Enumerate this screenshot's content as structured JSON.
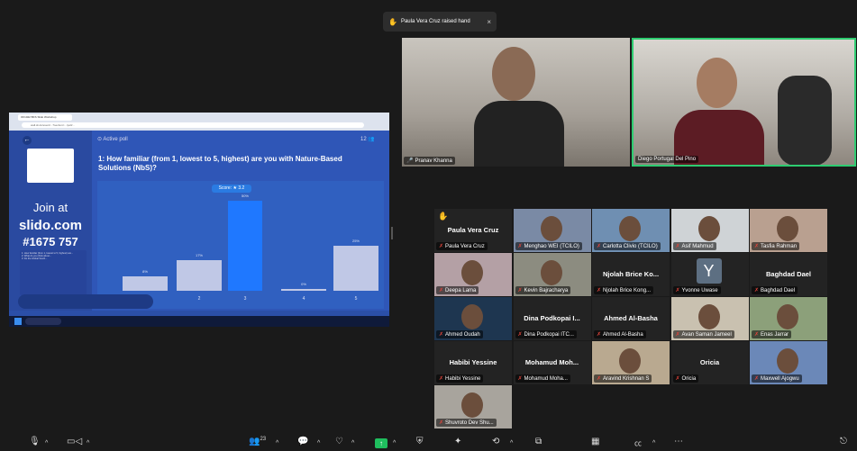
{
  "notification": {
    "text": "Paula Vera Cruz raised hand",
    "close": "×",
    "hand_icon": "raised-hand-icon"
  },
  "shared_screen": {
    "browser_tab": "OF1022 BKS Slido Workshop",
    "browser_url": "wall.sli.do/event/...?section=.../poll/...",
    "slido": {
      "back": "←",
      "active_poll": "Active poll",
      "participant_count": "12",
      "join_label": "Join at",
      "site": "slido.com",
      "code": "#1675 757",
      "question": "1: How familiar (from 1, lowest to 5, highest) are you with Nature-Based Solutions (NbS)?",
      "score_badge": "Score: ★ 3.2",
      "question_list": [
        "1: How familiar (from 1, lowest to 5, highest) are...",
        "2: What do you think about...",
        "3: Do the Global South..."
      ]
    }
  },
  "chart_data": {
    "type": "bar",
    "categories": [
      "1",
      "2",
      "3",
      "4",
      "5"
    ],
    "values": [
      8,
      17,
      50,
      0,
      25
    ],
    "value_labels": [
      "8%",
      "17%",
      "50%",
      "0%",
      "25%"
    ],
    "highlight_index": 2,
    "ylim": [
      0,
      50
    ],
    "title": "1: How familiar (from 1, lowest to 5, highest) are you with Nature-Based Solutions (NbS)?"
  },
  "top_videos": [
    {
      "name": "Pranav Khanna",
      "bg": "#b8b3ac"
    },
    {
      "name": "Diego Portugal Del Pino",
      "bg": "#a8a39b"
    }
  ],
  "gallery": [
    {
      "name": "Paula Vera Cruz",
      "label": "Paula Vera Cruz",
      "video": false,
      "hand": true
    },
    {
      "name": "Menghao WEI (TCILO)",
      "video": true,
      "bg": "#7a8aa5"
    },
    {
      "name": "Carlotta Clivio (TCILO)",
      "video": true,
      "bg": "#6f8fb2"
    },
    {
      "name": "Asif Mahmud",
      "video": true,
      "bg": "#cfd3d6"
    },
    {
      "name": "Tasfia Rahman",
      "video": true,
      "bg": "#b9a090"
    },
    {
      "name": "Deepa Lama",
      "video": true,
      "bg": "#b4a0a5"
    },
    {
      "name": "Kevin Bajracharya",
      "video": true,
      "bg": "#8c8c80"
    },
    {
      "name": "Njolah Brice Kong...",
      "label": "Njolah Brice Ko...",
      "video": false
    },
    {
      "name": "Yvonne Uwase",
      "avatar": "Y",
      "video": false
    },
    {
      "name": "Baghdad Dael",
      "label": "Baghdad Dael",
      "video": false
    },
    {
      "name": "Ahmed Oudah",
      "video": true,
      "bg": "#1e3650"
    },
    {
      "name": "Dina Podkopai ITC...",
      "label": "Dina Podkopai I...",
      "video": false
    },
    {
      "name": "Ahmed Al-Basha",
      "label": "Ahmed Al-Basha",
      "video": false
    },
    {
      "name": "Avan Saman Jameel",
      "video": true,
      "bg": "#c9c1b0"
    },
    {
      "name": "Enas Jarrar",
      "video": true,
      "bg": "#8ca07a"
    },
    {
      "name": "Habibi Yessine",
      "label": "Habibi Yessine",
      "video": false
    },
    {
      "name": "Mohamud Moha...",
      "label": "Mohamud Moh...",
      "video": false
    },
    {
      "name": "Aravind Krishnan S",
      "video": true,
      "bg": "#b9a990"
    },
    {
      "name": "Oricia",
      "label": "Oricia",
      "video": false
    },
    {
      "name": "Maxwell Ajogwu",
      "video": true,
      "bg": "#6b88b8"
    },
    {
      "name": "Shuvroto Dev Shu...",
      "video": true,
      "bg": "#a8a49d"
    }
  ],
  "toolbar": {
    "participants_count": "23"
  },
  "colors": {
    "speaker_border": "#2ecc71",
    "mic_muted": "#e0443a",
    "slido_bar": "#1f78ff",
    "slido_bg": "#2f56b7"
  }
}
